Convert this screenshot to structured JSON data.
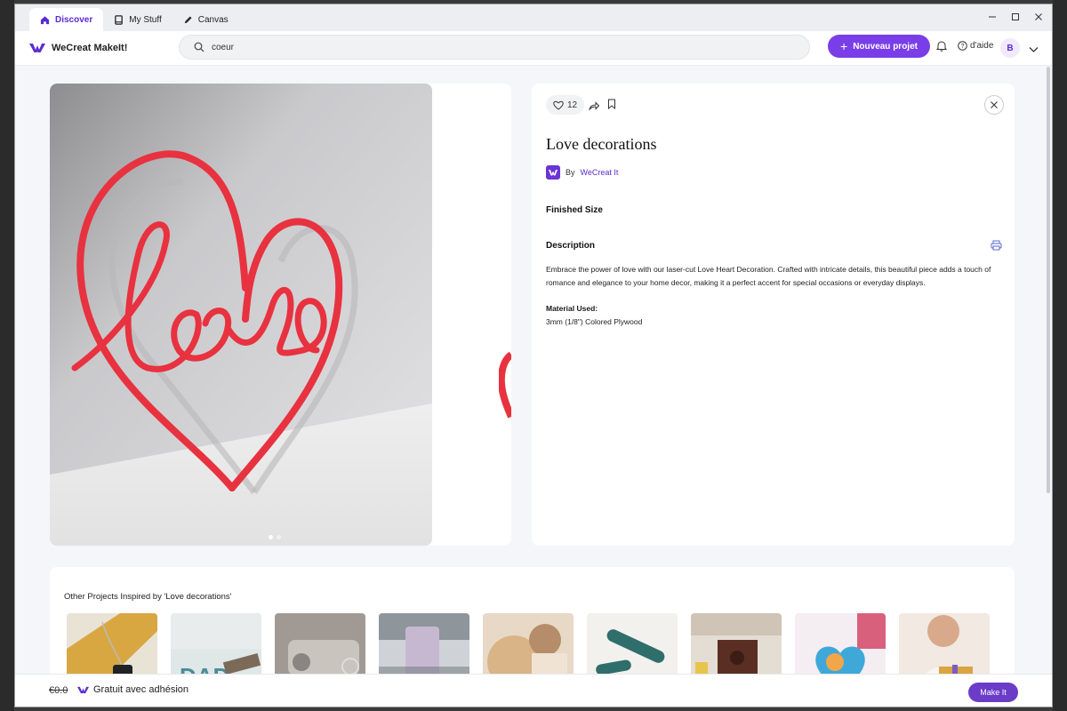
{
  "tabs": [
    {
      "label": "Discover",
      "icon": "home-icon",
      "active": true
    },
    {
      "label": "My Stuff",
      "icon": "book-icon",
      "active": false
    },
    {
      "label": "Canvas",
      "icon": "pencil-icon",
      "active": false
    }
  ],
  "topbar": {
    "brand": "WeCreat MakeIt!",
    "search_value": "coeur",
    "new_project_label": "Nouveau projet",
    "help_label": "d'aide",
    "avatar_initial": "B"
  },
  "project": {
    "likes": "12",
    "title": "Love decorations",
    "by_label": "By",
    "author": "WeCreat It",
    "finished_size_label": "Finished Size",
    "description_label": "Description",
    "description": "Embrace the power of love with our laser-cut Love Heart Decoration. Crafted with intricate details, this beautiful piece adds a touch of romance and elegance to your home decor, making it a perfect accent for special occasions or everyday displays.",
    "material_label": "Material Used:",
    "material_value": "3mm (1/8\") Colored Plywood"
  },
  "related": {
    "title": "Other Projects Inspired by 'Love decorations'",
    "thumbnails": 9
  },
  "footer": {
    "price": "€0.0",
    "free_label": "Gratuit avec adhésion",
    "make_label": "Make It"
  },
  "colors": {
    "accent": "#7a3ee8",
    "brand_purple": "#5b2bd1",
    "heart_red": "#e8323f"
  }
}
